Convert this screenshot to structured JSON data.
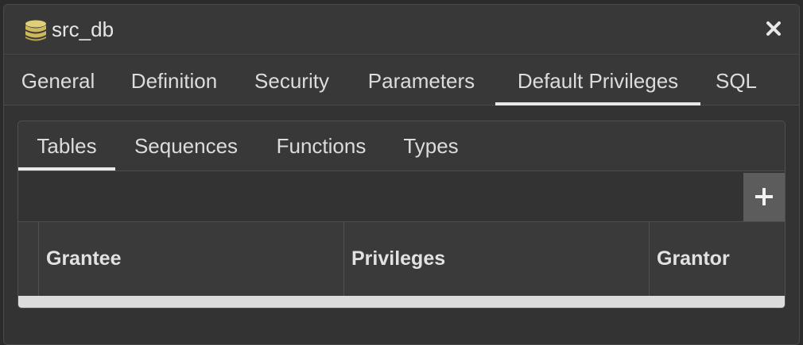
{
  "dialog": {
    "title": "src_db",
    "icon": "database-icon",
    "close_icon": "close-icon"
  },
  "main_tabs": [
    {
      "label": "General"
    },
    {
      "label": "Definition"
    },
    {
      "label": "Security"
    },
    {
      "label": "Parameters"
    },
    {
      "label": "Default Privileges",
      "active": true
    },
    {
      "label": "SQL"
    }
  ],
  "sub_tabs": [
    {
      "label": "Tables",
      "active": true
    },
    {
      "label": "Sequences"
    },
    {
      "label": "Functions"
    },
    {
      "label": "Types"
    }
  ],
  "toolbar": {
    "add_icon": "plus-icon"
  },
  "grid": {
    "columns": [
      "Grantee",
      "Privileges",
      "Grantor"
    ]
  },
  "colors": {
    "background": "#333333",
    "header": "#383838",
    "text": "#dcdcdc",
    "accent_underline": "#e8e8e8",
    "icon_gold": "#d4c06a"
  }
}
